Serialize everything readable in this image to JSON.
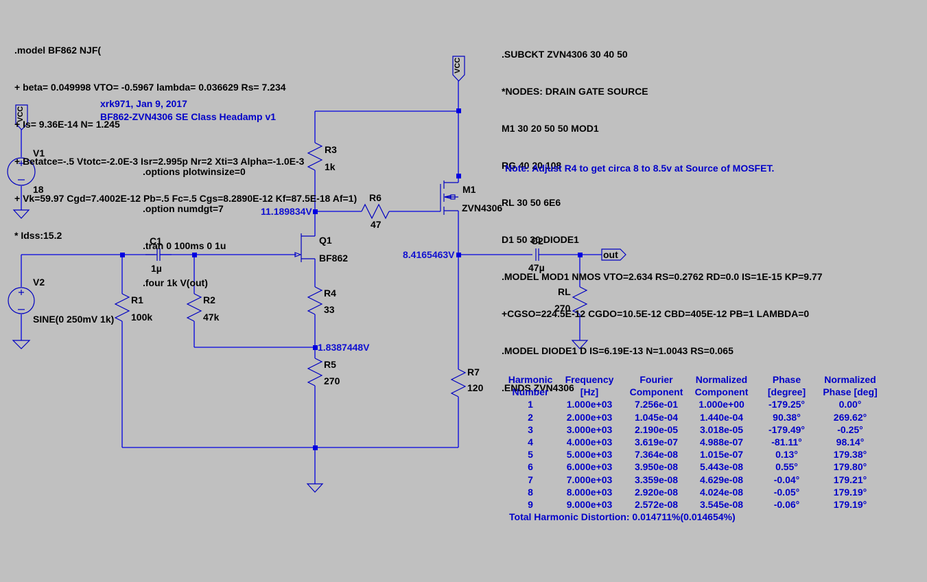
{
  "spice_model_bf862": {
    "lines": [
      ".model BF862 NJF(",
      "+ beta= 0.049998 VTO= -0.5967 lambda= 0.036629 Rs= 7.234",
      "+ Is= 9.36E-14 N= 1.245",
      "+ Betatce=-.5 Vtotc=-2.0E-3 Isr=2.995p Nr=2 Xti=3 Alpha=-1.0E-3",
      "+ Vk=59.97 Cgd=7.4002E-12 Pb=.5 Fc=.5 Cgs=8.2890E-12 Kf=87.5E-18 Af=1)",
      "* Idss:15.2"
    ]
  },
  "subckt_zvn4306": {
    "lines": [
      ".SUBCKT ZVN4306 30 40 50",
      "*NODES: DRAIN GATE SOURCE",
      "M1 30 20 50 50 MOD1",
      "RG 40 20 108",
      "RL 30 50 6E6",
      "D1 50 30 DIODE1",
      ".MODEL MOD1 NMOS VTO=2.634 RS=0.2762 RD=0.0 IS=1E-15 KP=9.77",
      "+CGSO=224.5E-12 CGDO=10.5E-12 CBD=405E-12 PB=1 LAMBDA=0",
      ".MODEL DIODE1 D IS=6.19E-13 N=1.0043 RS=0.065",
      ".ENDS ZVN4306"
    ]
  },
  "header": {
    "author": "xrk971, Jan 9, 2017",
    "title": "BF862-ZVN4306 SE Class Headamp v1"
  },
  "note": "Note: Adjust R4 to get circa 8 to 8.5v at Source of MOSFET.",
  "directives": [
    ".options plotwinsize=0",
    ".option numdgt=7",
    ".tran 0 100ms 0 1u",
    ".four 1k V(out)"
  ],
  "components": {
    "V1": {
      "name": "V1",
      "value": "18"
    },
    "V2": {
      "name": "V2",
      "value": "SINE(0 250mV 1k)"
    },
    "R1": {
      "name": "R1",
      "value": "100k"
    },
    "R2": {
      "name": "R2",
      "value": "47k"
    },
    "R3": {
      "name": "R3",
      "value": "1k"
    },
    "R4": {
      "name": "R4",
      "value": "33"
    },
    "R5": {
      "name": "R5",
      "value": "270"
    },
    "R6": {
      "name": "R6",
      "value": "47"
    },
    "R7": {
      "name": "R7",
      "value": "120"
    },
    "RL": {
      "name": "RL",
      "value": "270"
    },
    "C1": {
      "name": "C1",
      "value": "1µ"
    },
    "C2": {
      "name": "C2",
      "value": "47µ"
    },
    "Q1": {
      "name": "Q1",
      "value": "BF862"
    },
    "M1": {
      "name": "M1",
      "value": "ZVN4306"
    }
  },
  "net_labels": {
    "vcc_left": "VCC",
    "vcc_right": "VCC",
    "out": "out"
  },
  "node_voltages": {
    "q1_drain": "11.189834V",
    "m1_source": "8.4165463V",
    "q1_source_r4r5": "1.8387448V"
  },
  "fourier": {
    "headers": [
      [
        "Harmonic",
        "Number"
      ],
      [
        "Frequency",
        "[Hz]"
      ],
      [
        "Fourier",
        "Component"
      ],
      [
        "Normalized",
        "Component"
      ],
      [
        "Phase",
        "[degree]"
      ],
      [
        "Normalized",
        "Phase [deg]"
      ]
    ],
    "rows": [
      [
        "1",
        "1.000e+03",
        "7.256e-01",
        "1.000e+00",
        "-179.25°",
        "0.00°"
      ],
      [
        "2",
        "2.000e+03",
        "1.045e-04",
        "1.440e-04",
        "90.38°",
        "269.62°"
      ],
      [
        "3",
        "3.000e+03",
        "2.190e-05",
        "3.018e-05",
        "-179.49°",
        "-0.25°"
      ],
      [
        "4",
        "4.000e+03",
        "3.619e-07",
        "4.988e-07",
        "-81.11°",
        "98.14°"
      ],
      [
        "5",
        "5.000e+03",
        "7.364e-08",
        "1.015e-07",
        "0.13°",
        "179.38°"
      ],
      [
        "6",
        "6.000e+03",
        "3.950e-08",
        "5.443e-08",
        "0.55°",
        "179.80°"
      ],
      [
        "7",
        "7.000e+03",
        "3.359e-08",
        "4.629e-08",
        "-0.04°",
        "179.21°"
      ],
      [
        "8",
        "8.000e+03",
        "2.920e-08",
        "4.024e-08",
        "-0.05°",
        "179.19°"
      ],
      [
        "9",
        "9.000e+03",
        "2.572e-08",
        "3.545e-08",
        "-0.06°",
        "179.19°"
      ]
    ],
    "thd": "Total Harmonic Distortion: 0.014711%(0.014654%)"
  },
  "colors": {
    "background": "#c0c0c0",
    "wire": "#0000e0",
    "annotation_blue": "#0000c8",
    "text": "#000000"
  }
}
